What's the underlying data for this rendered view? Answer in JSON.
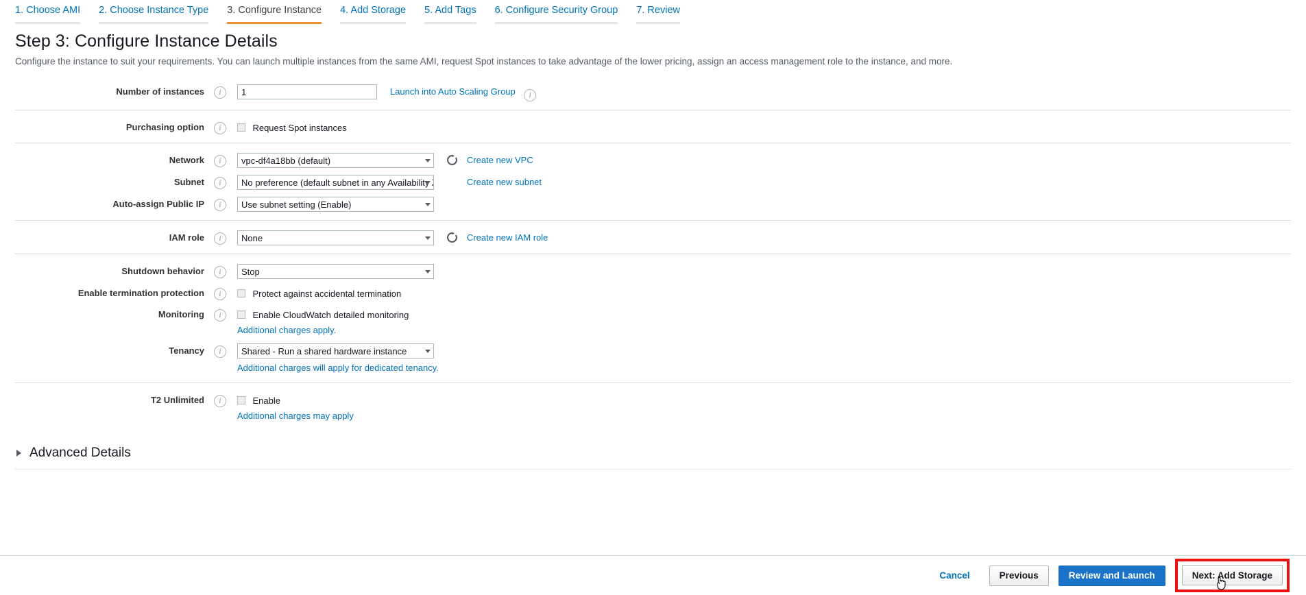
{
  "wizard": {
    "tabs": [
      {
        "label": "1. Choose AMI",
        "active": false
      },
      {
        "label": "2. Choose Instance Type",
        "active": false
      },
      {
        "label": "3. Configure Instance",
        "active": true
      },
      {
        "label": "4. Add Storage",
        "active": false
      },
      {
        "label": "5. Add Tags",
        "active": false
      },
      {
        "label": "6. Configure Security Group",
        "active": false
      },
      {
        "label": "7. Review",
        "active": false
      }
    ],
    "active_accent": "#ec912d",
    "link_color": "#0073bb"
  },
  "page": {
    "title": "Step 3: Configure Instance Details",
    "description": "Configure the instance to suit your requirements. You can launch multiple instances from the same AMI, request Spot instances to take advantage of the lower pricing, assign an access management role to the instance, and more."
  },
  "form": {
    "number_of_instances": {
      "label": "Number of instances",
      "value": "1",
      "link": "Launch into Auto Scaling Group",
      "info_icon": "info-icon"
    },
    "purchasing_option": {
      "label": "Purchasing option",
      "checkbox_label": "Request Spot instances",
      "checked": false
    },
    "network": {
      "label": "Network",
      "value": "vpc-df4a18bb (default)",
      "refresh_icon": "refresh-icon",
      "link": "Create new VPC"
    },
    "subnet": {
      "label": "Subnet",
      "value": "No preference (default subnet in any Availability Zone)",
      "link": "Create new subnet"
    },
    "auto_assign_public_ip": {
      "label": "Auto-assign Public IP",
      "value": "Use subnet setting (Enable)"
    },
    "iam_role": {
      "label": "IAM role",
      "value": "None",
      "refresh_icon": "refresh-icon",
      "link": "Create new IAM role"
    },
    "shutdown_behavior": {
      "label": "Shutdown behavior",
      "value": "Stop"
    },
    "termination_protection": {
      "label": "Enable termination protection",
      "checkbox_label": "Protect against accidental termination",
      "checked": false
    },
    "monitoring": {
      "label": "Monitoring",
      "checkbox_label": "Enable CloudWatch detailed monitoring",
      "checked": false,
      "note": "Additional charges apply."
    },
    "tenancy": {
      "label": "Tenancy",
      "value": "Shared - Run a shared hardware instance",
      "note": "Additional charges will apply for dedicated tenancy."
    },
    "t2_unlimited": {
      "label": "T2 Unlimited",
      "checkbox_label": "Enable",
      "checked": false,
      "note": "Additional charges may apply"
    }
  },
  "advanced": {
    "title": "Advanced Details",
    "expanded": false,
    "caret_icon": "chevron-right-icon"
  },
  "footer": {
    "cancel": "Cancel",
    "previous": "Previous",
    "review_and_launch": "Review and Launch",
    "next": "Next: Add  Storage",
    "highlight_color": "#ee1111",
    "primary_color": "#1a73c8"
  }
}
